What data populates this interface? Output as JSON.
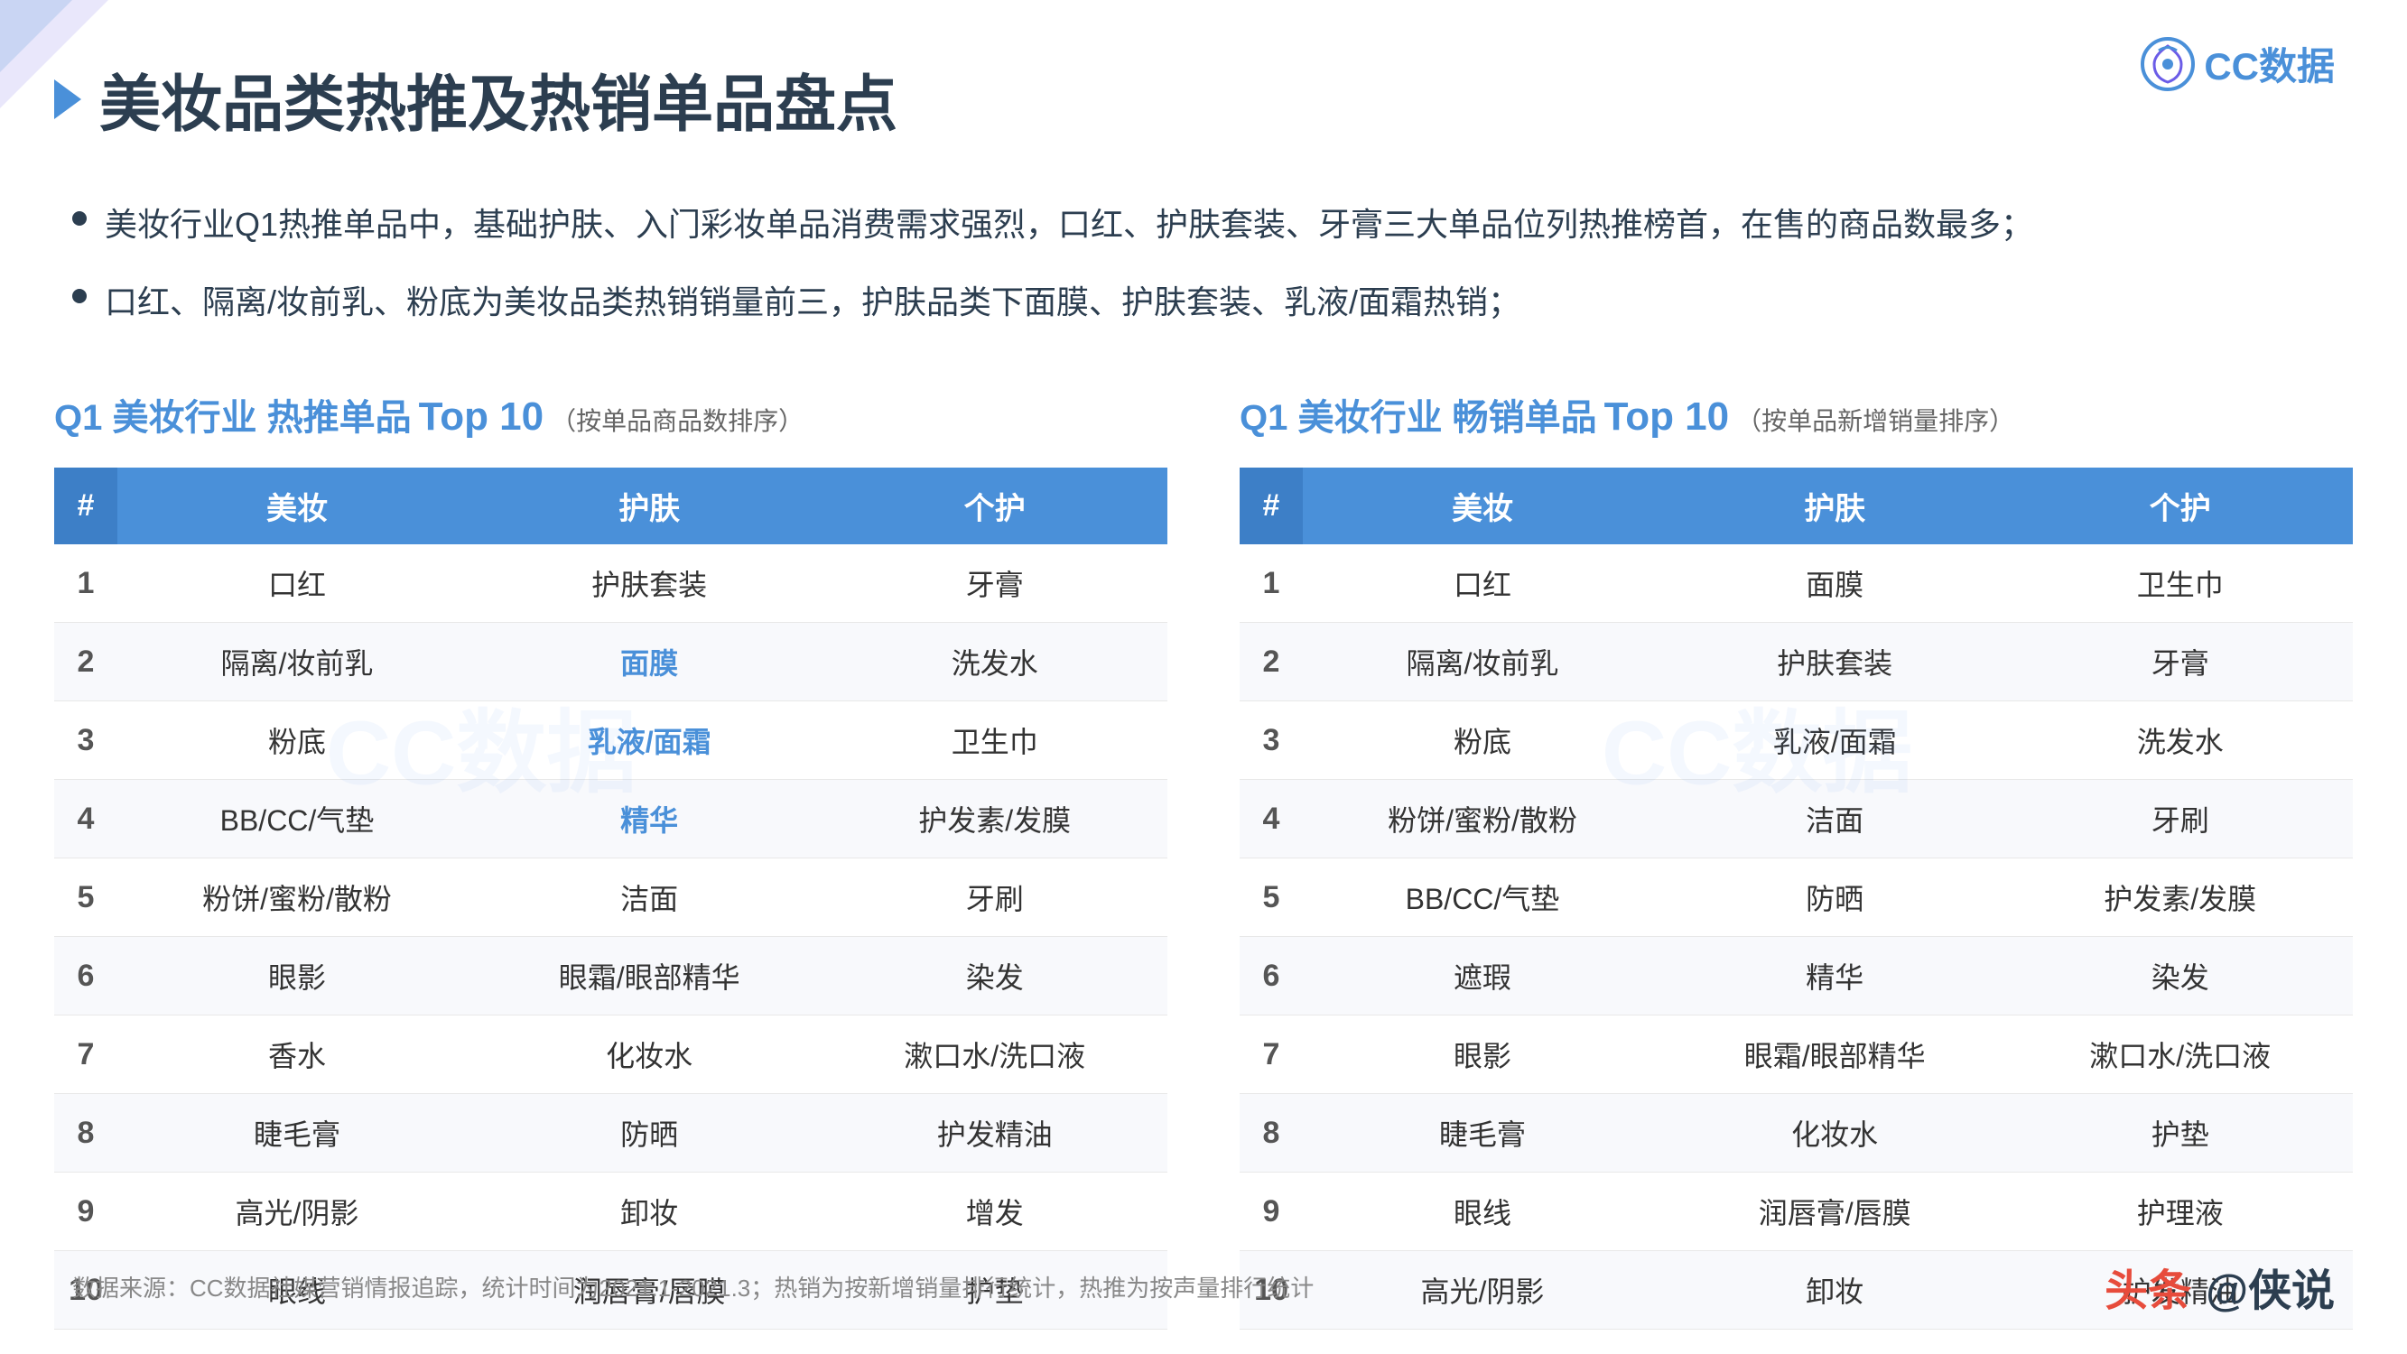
{
  "logo": {
    "text": "CC数据",
    "icon": "CC"
  },
  "page_title": "美妆品类热推及热销单品盘点",
  "bullets": [
    "美妆行业Q1热推单品中，基础护肤、入门彩妆单品消费需求强烈，口红、护肤套装、牙膏三大单品位列热推榜首，在售的商品数最多；",
    "口红、隔离/妆前乳、粉底为美妆品类热销销量前三，护肤品类下面膜、护肤套装、乳液/面霜热销；"
  ],
  "left_table": {
    "title_prefix": "Q1 美妆行业 热推单品",
    "title_top": "Top 10",
    "title_subtitle": "（按单品商品数排序）",
    "headers": [
      "#",
      "美妆",
      "护肤",
      "个护"
    ],
    "rows": [
      {
        "rank": "1",
        "col1": "口红",
        "col2": "护肤套装",
        "col3": "牙膏"
      },
      {
        "rank": "2",
        "col1": "隔离/妆前乳",
        "col2": "面膜",
        "col3": "洗发水",
        "highlight": "col2"
      },
      {
        "rank": "3",
        "col1": "粉底",
        "col2": "乳液/面霜",
        "col3": "卫生巾",
        "highlight": "col2"
      },
      {
        "rank": "4",
        "col1": "BB/CC/气垫",
        "col2": "精华",
        "col3": "护发素/发膜",
        "highlight": "col2"
      },
      {
        "rank": "5",
        "col1": "粉饼/蜜粉/散粉",
        "col2": "洁面",
        "col3": "牙刷"
      },
      {
        "rank": "6",
        "col1": "眼影",
        "col2": "眼霜/眼部精华",
        "col3": "染发"
      },
      {
        "rank": "7",
        "col1": "香水",
        "col2": "化妆水",
        "col3": "漱口水/洗口液"
      },
      {
        "rank": "8",
        "col1": "睫毛膏",
        "col2": "防晒",
        "col3": "护发精油"
      },
      {
        "rank": "9",
        "col1": "高光/阴影",
        "col2": "卸妆",
        "col3": "增发"
      },
      {
        "rank": "10",
        "col1": "眼线",
        "col2": "润唇膏/唇膜",
        "col3": "护垫"
      }
    ]
  },
  "right_table": {
    "title_prefix": "Q1 美妆行业 畅销单品",
    "title_top": "Top 10",
    "title_subtitle": "（按单品新增销量排序）",
    "headers": [
      "#",
      "美妆",
      "护肤",
      "个护"
    ],
    "rows": [
      {
        "rank": "1",
        "col1": "口红",
        "col2": "面膜",
        "col3": "卫生巾"
      },
      {
        "rank": "2",
        "col1": "隔离/妆前乳",
        "col2": "护肤套装",
        "col3": "牙膏"
      },
      {
        "rank": "3",
        "col1": "粉底",
        "col2": "乳液/面霜",
        "col3": "洗发水"
      },
      {
        "rank": "4",
        "col1": "粉饼/蜜粉/散粉",
        "col2": "洁面",
        "col3": "牙刷"
      },
      {
        "rank": "5",
        "col1": "BB/CC/气垫",
        "col2": "防晒",
        "col3": "护发素/发膜"
      },
      {
        "rank": "6",
        "col1": "遮瑕",
        "col2": "精华",
        "col3": "染发"
      },
      {
        "rank": "7",
        "col1": "眼影",
        "col2": "眼霜/眼部精华",
        "col3": "漱口水/洗口液"
      },
      {
        "rank": "8",
        "col1": "睫毛膏",
        "col2": "化妆水",
        "col3": "护垫"
      },
      {
        "rank": "9",
        "col1": "眼线",
        "col2": "润唇膏/唇膜",
        "col3": "护理液"
      },
      {
        "rank": "10",
        "col1": "高光/阴影",
        "col2": "卸妆",
        "col3": "护发精油"
      }
    ]
  },
  "footer": {
    "source_text": "数据来源：CC数据社媒营销情报追踪，统计时间为2021.1-2021.3；热销为按新增销量排行统计，热推为按声量排行统计",
    "brand": "头条 @侠说"
  },
  "watermark": "CC数据"
}
